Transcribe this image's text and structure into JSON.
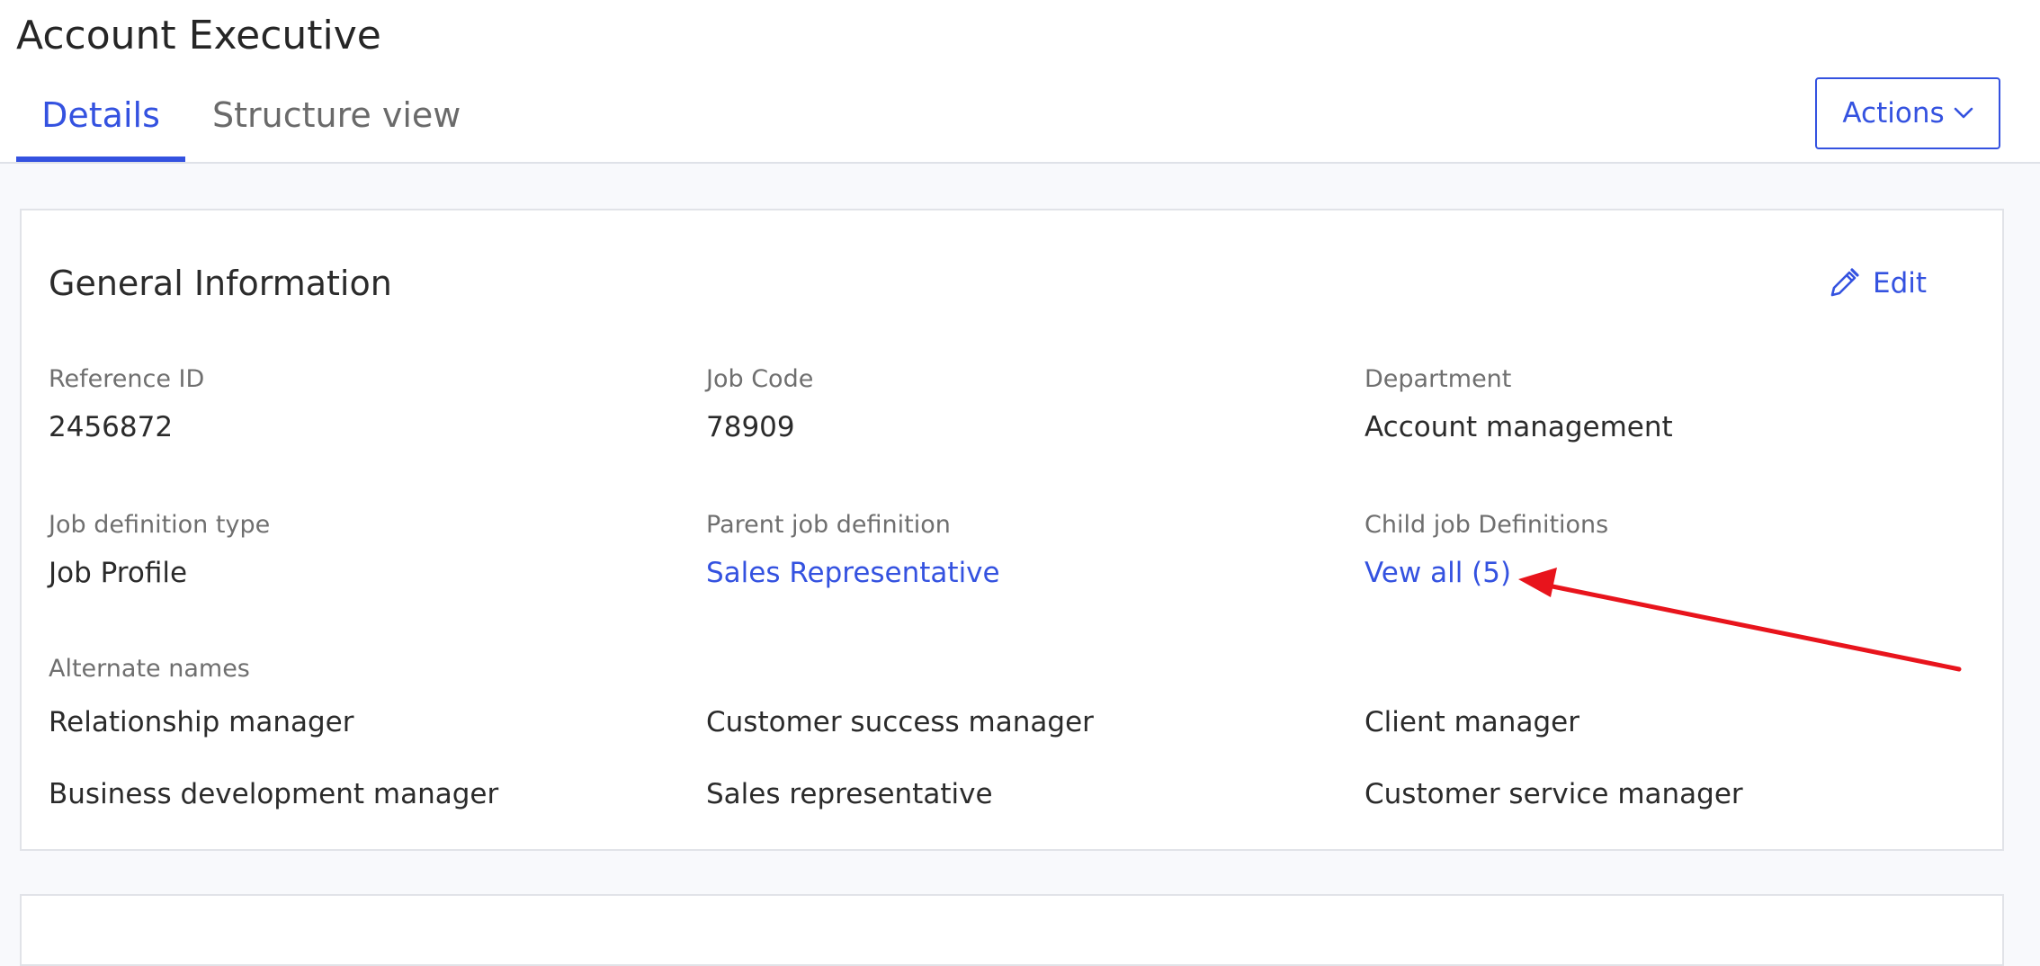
{
  "page": {
    "title": "Account Executive"
  },
  "tabs": [
    {
      "label": "Details",
      "active": true
    },
    {
      "label": "Structure view",
      "active": false
    }
  ],
  "actions": {
    "label": "Actions",
    "icon": "chevron-down-icon"
  },
  "general_information": {
    "title": "General Information",
    "edit_label": "Edit",
    "edit_icon": "pencil-icon",
    "fields": {
      "reference_id": {
        "label": "Reference ID",
        "value": "2456872"
      },
      "job_code": {
        "label": "Job Code",
        "value": "78909"
      },
      "department": {
        "label": "Department",
        "value": "Account management"
      },
      "job_definition_type": {
        "label": "Job definition type",
        "value": "Job Profile"
      },
      "parent_job_definition": {
        "label": "Parent job definition",
        "value": "Sales Representative"
      },
      "child_job_definitions": {
        "label": "Child job Definitions",
        "value": "Vew all (5)"
      }
    },
    "alternate_names": {
      "label": "Alternate names",
      "names": [
        "Relationship manager",
        "Customer success manager",
        "Client manager",
        "Business development manager",
        "Sales representative",
        "Customer service manager"
      ]
    }
  },
  "colors": {
    "accent": "#3452e0",
    "annotation_arrow": "#e8141c",
    "background": "#f8f9fc",
    "text": "#2b2b2b",
    "label_text": "#6f6f6f"
  }
}
